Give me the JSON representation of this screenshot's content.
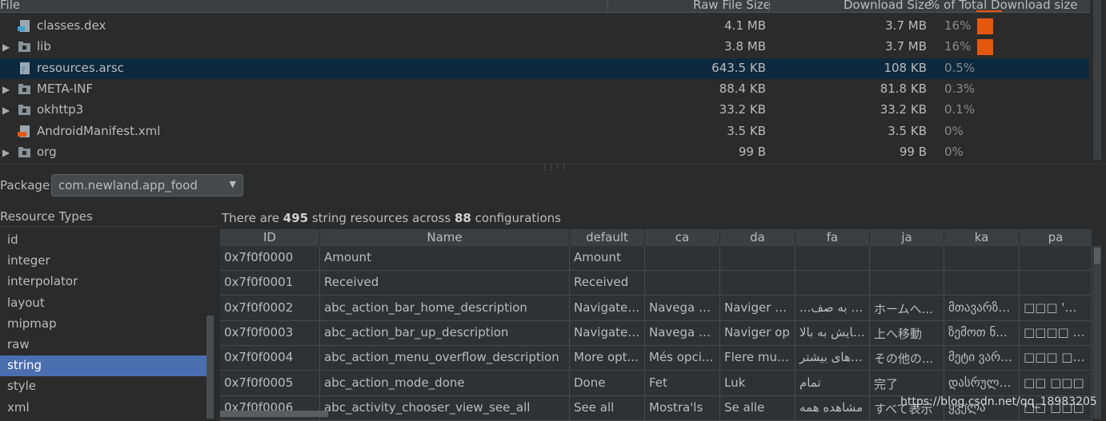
{
  "file_table": {
    "headers": {
      "file": "File",
      "raw_size": "Raw File Size",
      "download_size": "Download Size",
      "pct_total": "% of Total Download size"
    },
    "rows": [
      {
        "name": "classes.dex",
        "icon": "dex-file-icon",
        "expandable": false,
        "raw": "4.1 MB",
        "download": "3.7 MB",
        "pct": "16%",
        "bar": 0.16
      },
      {
        "name": "lib",
        "icon": "folder-icon",
        "expandable": true,
        "raw": "3.8 MB",
        "download": "3.7 MB",
        "pct": "16%",
        "bar": 0.16
      },
      {
        "name": "resources.arsc",
        "icon": "unknown-file-icon",
        "expandable": false,
        "raw": "643.5 KB",
        "download": "108 KB",
        "pct": "0.5%",
        "bar": 0
      },
      {
        "name": "META-INF",
        "icon": "folder-icon",
        "expandable": true,
        "raw": "88.4 KB",
        "download": "81.8 KB",
        "pct": "0.3%",
        "bar": 0
      },
      {
        "name": "okhttp3",
        "icon": "folder-icon",
        "expandable": true,
        "raw": "33.2 KB",
        "download": "33.2 KB",
        "pct": "0.1%",
        "bar": 0
      },
      {
        "name": "AndroidManifest.xml",
        "icon": "xml-file-icon",
        "expandable": false,
        "raw": "3.5 KB",
        "download": "3.5 KB",
        "pct": "0%",
        "bar": 0
      },
      {
        "name": "org",
        "icon": "folder-icon",
        "expandable": true,
        "raw": "99 B",
        "download": "99 B",
        "pct": "0%",
        "bar": 0
      }
    ],
    "selected_index": 2,
    "bar_color": "#e4570f",
    "selection_color": "#0d293e"
  },
  "package": {
    "label": "Package:",
    "value": "com.newland.app_food"
  },
  "resource_types": {
    "title": "Resource Types",
    "items": [
      "id",
      "integer",
      "interpolator",
      "layout",
      "mipmap",
      "raw",
      "string",
      "style",
      "xml"
    ],
    "selected": "string",
    "selection_color": "#4b6eaf"
  },
  "summary": {
    "prefix": "There are ",
    "count": "495",
    "middle": " string resources across ",
    "configs": "88",
    "suffix": " configurations"
  },
  "grid": {
    "columns": [
      "ID",
      "Name",
      "default",
      "ca",
      "da",
      "fa",
      "ja",
      "ka",
      "pa"
    ],
    "rows": [
      [
        "0x7f0f0000",
        "Amount",
        "Amount",
        "",
        "",
        "",
        "",
        "",
        ""
      ],
      [
        "0x7f0f0001",
        "Received",
        "Received",
        "",
        "",
        "",
        "",
        "",
        ""
      ],
      [
        "0x7f0f0002",
        "abc_action_bar_home_description",
        "Navigate ...",
        "Navega a ...",
        "Naviger h...",
        "...پیمایش به صف",
        "ホームへ...",
        "მთავარზე...",
        "□□□ '□□ □□□"
      ],
      [
        "0x7f0f0003",
        "abc_action_bar_up_description",
        "Navigate ...",
        "Navega c...",
        "Naviger op",
        "پیمایش به بالا",
        "上へ移動",
        "ზემოთ ნ...",
        "□□□□ □□□"
      ],
      [
        "0x7f0f0004",
        "abc_action_menu_overflow_description",
        "More opt...",
        "Més opci...",
        "Flere muli...",
        "گزینه‌های بیشتر",
        "その他の...",
        "მეტი ვარი...",
        "□□□ □□□□□"
      ],
      [
        "0x7f0f0005",
        "abc_action_mode_done",
        "Done",
        "Fet",
        "Luk",
        "تمام",
        "完了",
        "დასრულდა",
        "□□ □□□"
      ],
      [
        "0x7f0f0006",
        "abc_activity_chooser_view_see_all",
        "See all",
        "Mostra'ls",
        "Se alle",
        "مشاهده همه",
        "すべて表示",
        "ყველა",
        "□□ □□□"
      ]
    ]
  },
  "watermark": "https://blog.csdn.net/qq_18983205"
}
